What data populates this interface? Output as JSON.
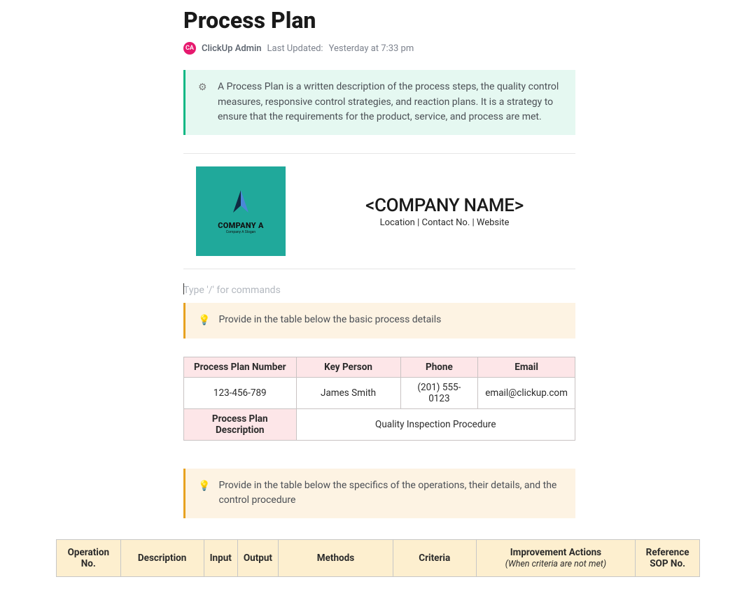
{
  "title": "Process Plan",
  "author": {
    "initials": "CA",
    "name": "ClickUp Admin"
  },
  "last_updated_label": "Last Updated:",
  "last_updated_value": "Yesterday at 7:33 pm",
  "callout_intro": "A Process Plan is a written description of the process steps, the quality control measures, responsive control strategies, and reaction plans. It is a strategy to ensure that the requirements for the product, service, and process are met.",
  "logo": {
    "name": "COMPANY A",
    "slogan": "Company A Slogan"
  },
  "company": {
    "name": "<COMPANY NAME>",
    "subline": "Location | Contact No. | Website"
  },
  "slash_placeholder": "Type '/' for commands",
  "callout_details": "Provide in the table below the basic process details",
  "details_table": {
    "headers": [
      "Process Plan Number",
      "Key Person",
      "Phone",
      "Email"
    ],
    "row": [
      "123-456-789",
      "James Smith",
      "(201) 555-0123",
      "email@clickup.com"
    ],
    "desc_label": "Process Plan Description",
    "desc_value": "Quality Inspection Procedure"
  },
  "callout_ops": "Provide in the table below the specifics of the operations, their details, and the control procedure",
  "ops_table": {
    "headers": [
      {
        "label": "Operation No."
      },
      {
        "label": "Description"
      },
      {
        "label": "Input"
      },
      {
        "label": "Output"
      },
      {
        "label": "Methods"
      },
      {
        "label": "Criteria"
      },
      {
        "label": "Improvement Actions",
        "sub": "(When criteria are not met)"
      },
      {
        "label": "Reference SOP No."
      }
    ]
  }
}
